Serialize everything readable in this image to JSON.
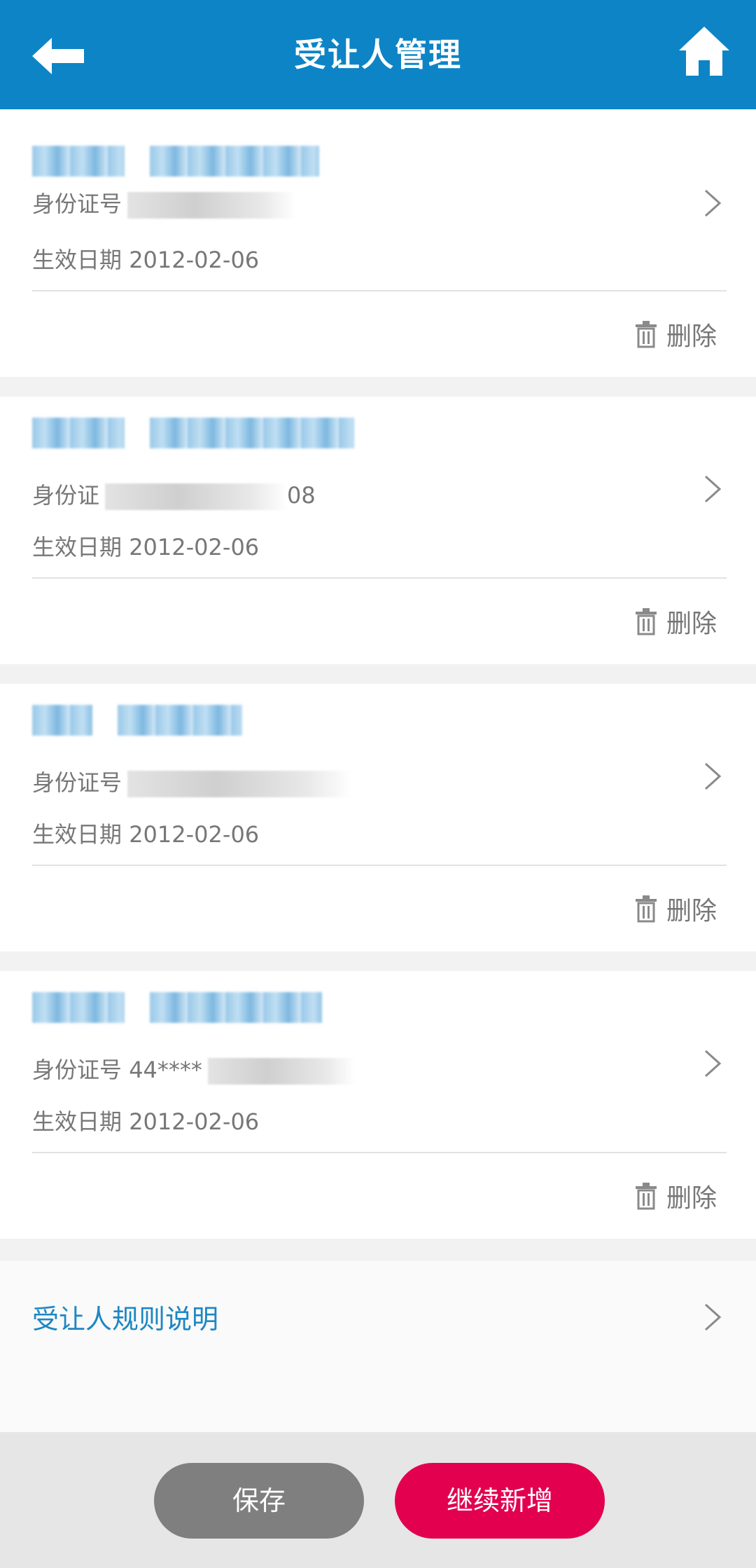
{
  "header": {
    "title": "受让人管理",
    "color": "#0d84c6"
  },
  "cards": [
    {
      "id_label": "身份证号",
      "id_value_visible": "",
      "date_label": "生效日期",
      "date_value": "2012-02-06",
      "delete_label": "删除"
    },
    {
      "id_label": "身份证",
      "id_value_visible": "08",
      "date_label": "生效日期",
      "date_value": "2012-02-06",
      "delete_label": "删除"
    },
    {
      "id_label": "身份证号",
      "id_value_visible": "",
      "date_label": "生效日期",
      "date_value": "2012-02-06",
      "delete_label": "删除"
    },
    {
      "id_label": "身份证号",
      "id_value_visible": "44****",
      "date_label": "生效日期",
      "date_value": "2012-02-06",
      "delete_label": "删除"
    }
  ],
  "rules": {
    "label": "受让人规则说明"
  },
  "footer": {
    "save_label": "保存",
    "add_label": "继续新增",
    "save_color": "#7f7f7f",
    "add_color": "#e2004f"
  },
  "icons": {
    "back": "back-arrow-icon",
    "home": "home-icon",
    "chevron": "chevron-right-icon",
    "trash": "trash-icon"
  }
}
